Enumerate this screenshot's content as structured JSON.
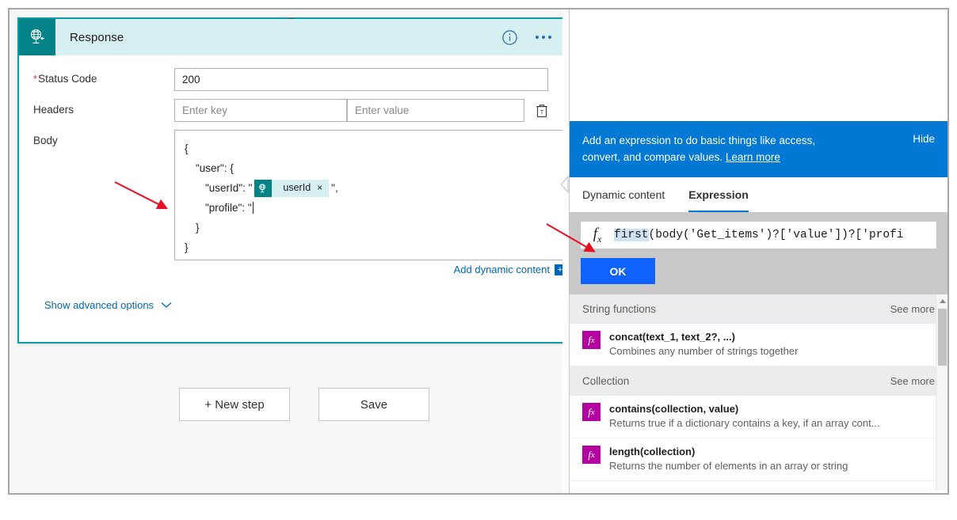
{
  "card": {
    "title": "Response",
    "icon": "response-globe-icon",
    "accent_color": "#038387",
    "header_bg": "#d6eff1",
    "info_icon": "info-icon",
    "more_icon": "ellipsis-icon",
    "fields": {
      "status_code": {
        "label": "Status Code",
        "required": true,
        "value": "200"
      },
      "headers": {
        "label": "Headers",
        "key_placeholder": "Enter key",
        "value_placeholder": "Enter value",
        "delete_icon": "delete-row-icon"
      },
      "body": {
        "label": "Body",
        "lines": [
          {
            "indent": 0,
            "text": "{"
          },
          {
            "indent": 1,
            "text": "\"user\": {"
          },
          {
            "indent": 2,
            "text": "\"userId\": \""
          },
          {
            "indent": 2,
            "text": "\"profile\": \""
          },
          {
            "indent": 1,
            "text": "}"
          },
          {
            "indent": 0,
            "text": "}"
          }
        ],
        "token": {
          "label": "userId",
          "icon": "dynamic-content-token-icon",
          "remove": "×"
        },
        "trailing_after_token": "\",",
        "add_dynamic_content": "Add dynamic content",
        "add_dynamic_badge": "+"
      }
    },
    "advanced_options": "Show advanced options",
    "advanced_chevron": "chevron-down-icon"
  },
  "toolbar": {
    "new_step_label": "+ New step",
    "save_label": "Save"
  },
  "expression_panel": {
    "banner": {
      "text": "Add an expression to do basic things like access, convert, and compare values.",
      "link": "Learn more",
      "hide": "Hide",
      "bg": "#0078d4"
    },
    "tabs": [
      {
        "label": "Dynamic content",
        "active": false
      },
      {
        "label": "Expression",
        "active": true
      }
    ],
    "expression_field": {
      "fx": "fx",
      "selected_text": "first",
      "rest_text": "(body('Get_items')?['value'])?['profi",
      "full_value": "first(body('Get_items')?['value'])?['profi"
    },
    "ok_label": "OK",
    "groups": [
      {
        "name": "String functions",
        "see_more": "See more",
        "items": [
          {
            "signature": "concat(text_1, text_2?, ...)",
            "description": "Combines any number of strings together"
          }
        ]
      },
      {
        "name": "Collection",
        "see_more": "See more",
        "items": [
          {
            "signature": "contains(collection, value)",
            "description": "Returns true if a dictionary contains a key, if an array cont..."
          },
          {
            "signature": "length(collection)",
            "description": "Returns the number of elements in an array or string"
          }
        ]
      }
    ],
    "collapse_icon": "chevron-left-icon",
    "scrollbar_up_icon": "scroll-up-arrow-icon"
  }
}
